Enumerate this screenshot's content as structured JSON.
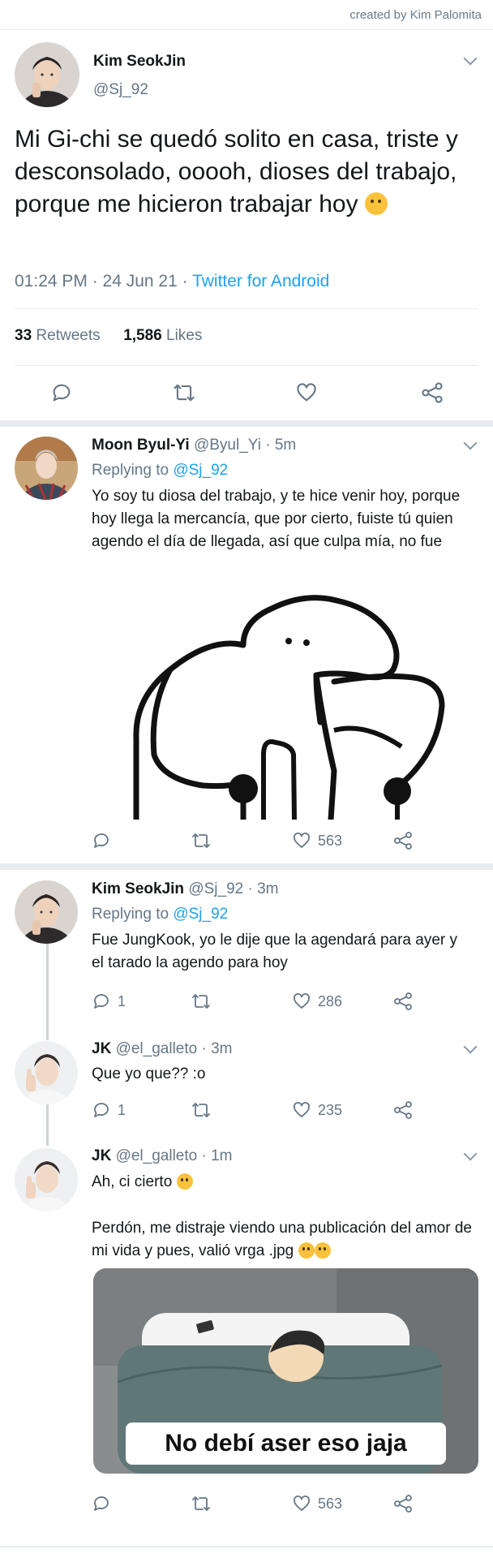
{
  "credit": "created by Kim Palomita",
  "main_tweet": {
    "name": "Kim SeokJin",
    "handle": "@Sj_92",
    "text": "Mi Gi-chi se quedó solito en casa, triste y desconsolado, ooooh, dioses del trabajo, porque me hicieron trabajar hoy",
    "emoji": "crying-face-emoji",
    "time": "01:24 PM · 24 Jun 21 · ",
    "source": "Twitter for Android",
    "retweets_count": "33",
    "retweets_label": "Retweets",
    "likes_count": "1,586",
    "likes_label": "Likes"
  },
  "replies": [
    {
      "name": "Moon Byul-Yi",
      "meta": "@Byul_Yi · 5m",
      "replying_label": "Replying to ",
      "replying_to": "@Sj_92",
      "text": "Yo soy tu diosa del trabajo, y te hice venir hoy, porque hoy llega la mercancía, que por cierto, fuiste tú quien agendo el día de llegada, así que culpa mía, no fue",
      "media": "flork-meme-drawing",
      "replies_count": "",
      "likes_count": "563"
    },
    {
      "name": "Kim SeokJin",
      "meta": "@Sj_92 · 3m",
      "replying_label": "Replying to ",
      "replying_to": "@Sj_92",
      "text": "Fue JungKook, yo le dije que la agendará para ayer y el tarado la agendo para hoy",
      "replies_count": "1",
      "likes_count": "286"
    },
    {
      "name": "JK",
      "meta": "@el_galleto · 3m",
      "text": "Que yo que?? :o",
      "replies_count": "1",
      "likes_count": "235"
    },
    {
      "name": "JK",
      "meta": "@el_galleto · 1m",
      "text_line1": "Ah, ci cierto",
      "text_line2": "Perdón, me distraje viendo una publicación del amor de mi vida y pues, valió vrga .jpg",
      "media_caption": "No debí aser eso jaja",
      "replies_count": "",
      "likes_count": "563"
    }
  ],
  "colors": {
    "link": "#1da1f2",
    "secondary_text": "#657786",
    "separator": "#e6ecf0"
  }
}
